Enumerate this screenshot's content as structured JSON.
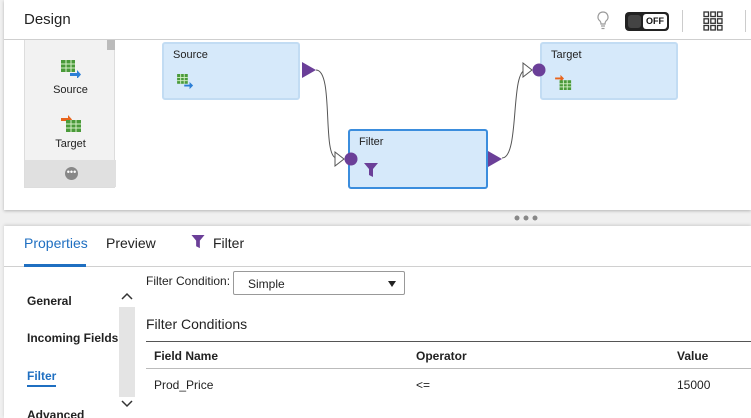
{
  "design": {
    "title": "Design",
    "toggle_label": "OFF"
  },
  "palette": {
    "items": [
      {
        "label": "Source",
        "icon": "source-table-icon"
      },
      {
        "label": "Target",
        "icon": "target-table-icon"
      }
    ],
    "more_icon": "more-icon"
  },
  "canvas": {
    "nodes": [
      {
        "label": "Source",
        "icon": "source-table-icon"
      },
      {
        "label": "Filter",
        "icon": "filter-icon"
      },
      {
        "label": "Target",
        "icon": "target-table-icon"
      }
    ]
  },
  "properties": {
    "tabs": [
      {
        "label": "Properties"
      },
      {
        "label": "Preview"
      },
      {
        "label": "Filter"
      }
    ],
    "nav": [
      {
        "label": "General"
      },
      {
        "label": "Incoming Fields"
      },
      {
        "label": "Filter"
      },
      {
        "label": "Advanced"
      }
    ],
    "filter_condition_label": "Filter Condition:",
    "filter_condition_value": "Simple",
    "section_title": "Filter Conditions",
    "columns": [
      "Field Name",
      "Operator",
      "Value"
    ],
    "rows": [
      {
        "field": "Prod_Price",
        "operator": "<=",
        "value": "15000"
      }
    ]
  },
  "colors": {
    "accent": "#1f6fc1",
    "node_fill": "#d6e9fa",
    "port": "#6b3f98"
  }
}
